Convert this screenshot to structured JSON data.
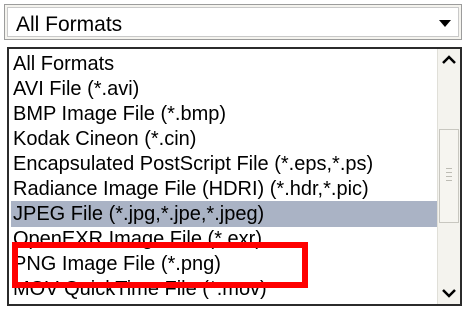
{
  "combo": {
    "selected_value": "All Formats",
    "arrow_icon": "chevron-down-icon"
  },
  "list": {
    "items": [
      {
        "label": "All Formats"
      },
      {
        "label": "AVI File (*.avi)"
      },
      {
        "label": "BMP Image File (*.bmp)"
      },
      {
        "label": "Kodak Cineon (*.cin)"
      },
      {
        "label": "Encapsulated PostScript File (*.eps,*.ps)"
      },
      {
        "label": "Radiance Image File (HDRI) (*.hdr,*.pic)"
      },
      {
        "label": "JPEG File (*.jpg,*.jpe,*.jpeg)",
        "selected": true
      },
      {
        "label": "OpenEXR Image File (*.exr)"
      },
      {
        "label": "PNG Image File (*.png)"
      },
      {
        "label": "MOV QuickTime File (*.mov)"
      }
    ],
    "selected_index": 6
  },
  "scrollbar": {
    "up_icon": "chevron-up-icon",
    "down_icon": "chevron-down-icon"
  },
  "colors": {
    "selection": "#aab3c5",
    "annotation": "#ff0000"
  }
}
